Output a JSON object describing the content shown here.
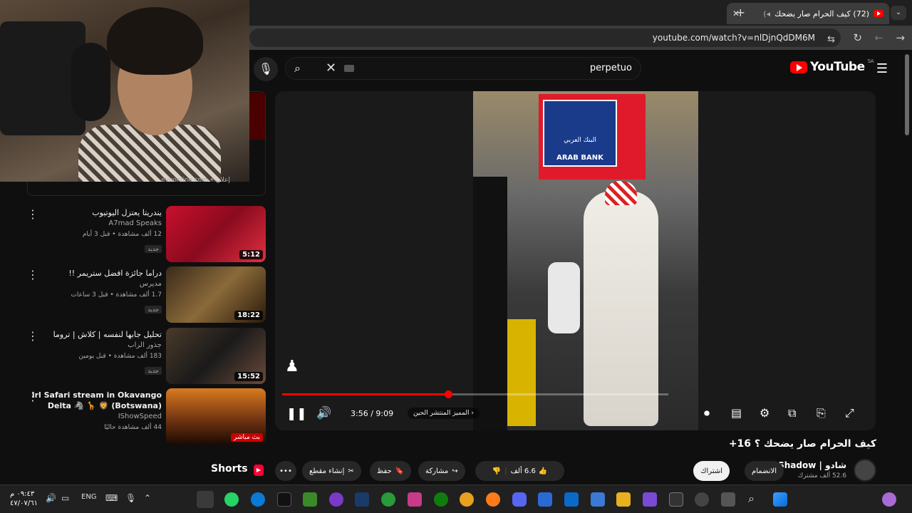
{
  "browser": {
    "tab_title": "(72) كيف الحرام صار يضحك",
    "tab_close": "✕",
    "new_tab": "+",
    "url": "youtube.com/watch?v=nlDjnQdDM6M"
  },
  "youtube": {
    "logo": "YouTube",
    "region": "SA",
    "search_query": "perpetuo",
    "ad_label": "eveonline.com • إعلان"
  },
  "sidebar": {
    "videos": [
      {
        "title": "يندريتا يعتزل اليوتيوب",
        "channel": "A7mad Speaks",
        "stats": "12 ألف مشاهدة • قبل 3 أيام",
        "badge": "جديد",
        "duration": "5:12"
      },
      {
        "title": "دراما جائزة افضل ستريمر !!",
        "channel": "مديرس",
        "stats": "1.7 ألف مشاهدة • قبل 3 ساعات",
        "badge": "جديد",
        "duration": "18:22"
      },
      {
        "title": "تحليل جابها لنفسه | كلاش | تروما",
        "channel": "جذور الراب",
        "stats": "183 ألف مشاهدة • قبل يومين",
        "badge": "جديد",
        "duration": "15:52"
      },
      {
        "title": "irl Safari stream in Okavango Delta 🦓 🦒 🦁 (Botswana)",
        "channel": "IShowSpeed",
        "stats": "44 ألف مشاهدة حاليًا",
        "badge": "",
        "duration": "بث مباشر"
      }
    ]
  },
  "player": {
    "time": "3:56 / 9:09",
    "chapter": "المميز المنتشر الحين",
    "progress_fraction": 0.43
  },
  "video": {
    "title": "كيف الحرام صار يضحك ؟ 16+",
    "channel_name": "شادو | Shadow",
    "subscribers": "52.6 ألف مشترك",
    "join_label": "الانضمام",
    "subscribe_label": "اشتراك",
    "likes": "6.6 ألف",
    "share_label": "مشاركة",
    "save_label": "حفظ",
    "clip_label": "إنشاء مقطع",
    "more_label": "•••",
    "shorts_label": "Shorts"
  },
  "taskbar": {
    "time": "٠٩:٤٣ م",
    "date": "٤٧/٠٧/٦١",
    "lang": "ENG"
  },
  "colors": {
    "accent": "#ff0000",
    "background": "#0f0f0f"
  }
}
